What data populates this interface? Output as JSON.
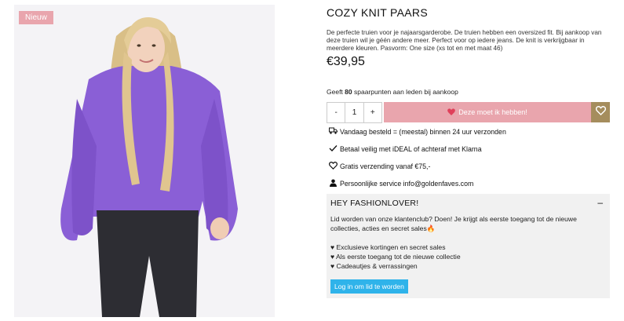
{
  "product": {
    "badge": "Nieuw",
    "title": "COZY KNIT PAARS",
    "description": "De perfecte truien voor je najaarsgarderobe. De truien hebben een oversized fit. Bij aankoop van deze truien wil je géén andere meer. Perfect voor op iedere jeans. De knit is verkrijgbaar in meerdere kleuren. Pasvorm: One size (xs tot en met maat 46)",
    "price": "€39,95",
    "points_prefix": "Geeft",
    "points_value": "80",
    "points_suffix": "spaarpunten aan leden bij aankoop",
    "image_icon": "model-wearing-purple-knit-sweater"
  },
  "purchase": {
    "qty_minus": "-",
    "qty_value": "1",
    "qty_plus": "+",
    "buy_label": "Deze moet ik hebben!",
    "buy_icon": "heart-icon",
    "wishlist_icon": "heart-outline-icon"
  },
  "usps": [
    {
      "icon": "truck-icon",
      "text": "Vandaag besteld = (meestal) binnen 24 uur verzonden"
    },
    {
      "icon": "check-icon",
      "text": "Betaal veilig met iDEAL of achteraf met Klarna"
    },
    {
      "icon": "heart-outline-icon",
      "text": "Gratis verzending vanaf €75,-"
    },
    {
      "icon": "user-icon",
      "text": "Persoonlijke service info@goldenfaves.com"
    }
  ],
  "club": {
    "heading": "HEY FASHIONLOVER!",
    "toggle": "–",
    "intro": "Lid worden van onze klantenclub? Doen! Je krijgt als eerste toegang tot de nieuwe collecties, acties en secret sales🔥",
    "perks": [
      "♥ Exclusieve kortingen en secret sales",
      "♥ Als eerste toegang tot de nieuwe collectie",
      "♥ Cadeautjes & verrassingen"
    ],
    "button_label": "Log in om lid te worden"
  },
  "colors": {
    "accent_pink": "#e9a5ad",
    "wishlist_gold": "#a58d5d",
    "button_blue": "#2fb3ea",
    "sweater_purple": "#8a5fd6"
  }
}
